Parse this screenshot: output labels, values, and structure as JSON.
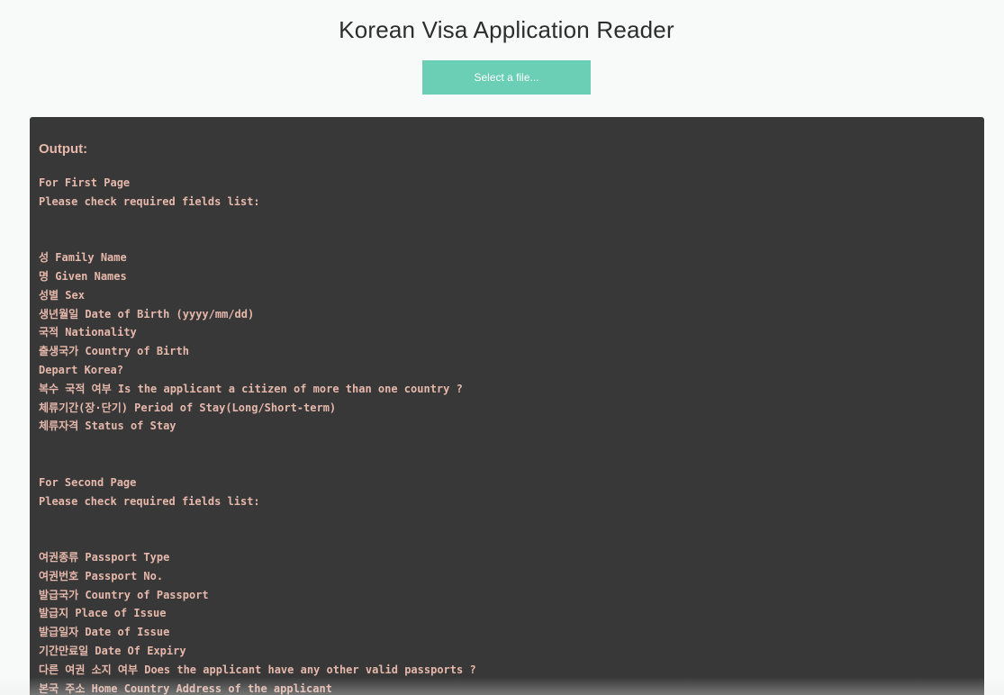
{
  "header": {
    "title": "Korean Visa Application Reader"
  },
  "file_button": {
    "label": "Select a file..."
  },
  "output": {
    "heading": "Output:",
    "lines": [
      "For First Page",
      "Please check required fields list:",
      "",
      "",
      "성 Family Name",
      "명 Given Names",
      "성별 Sex",
      "생년월일 Date of Birth (yyyy/mm/dd)",
      "국적 Nationality",
      "출생국가 Country of Birth",
      "Depart Korea?",
      "복수 국적 여부 Is the applicant a citizen of more than one country ?",
      "체류기간(장·단기) Period of Stay(Long/Short-term)",
      "체류자격 Status of Stay",
      "",
      "",
      "For Second Page",
      "Please check required fields list:",
      "",
      "",
      "여권종류 Passport Type",
      "여권번호 Passport No.",
      "발급국가 Country of Passport",
      "발급지 Place of Issue",
      "발급일자 Date of Issue",
      "기간만료일 Date Of Expiry",
      "다른 여권 소지 여부 Does the applicant have any other valid passports ?",
      "본국 주소 Home Country Address of the applicant"
    ]
  },
  "colors": {
    "accent": "#6acfb4",
    "panel_background": "#383838",
    "output_text": "#e6b8ab",
    "page_background": "#f7faf9"
  }
}
